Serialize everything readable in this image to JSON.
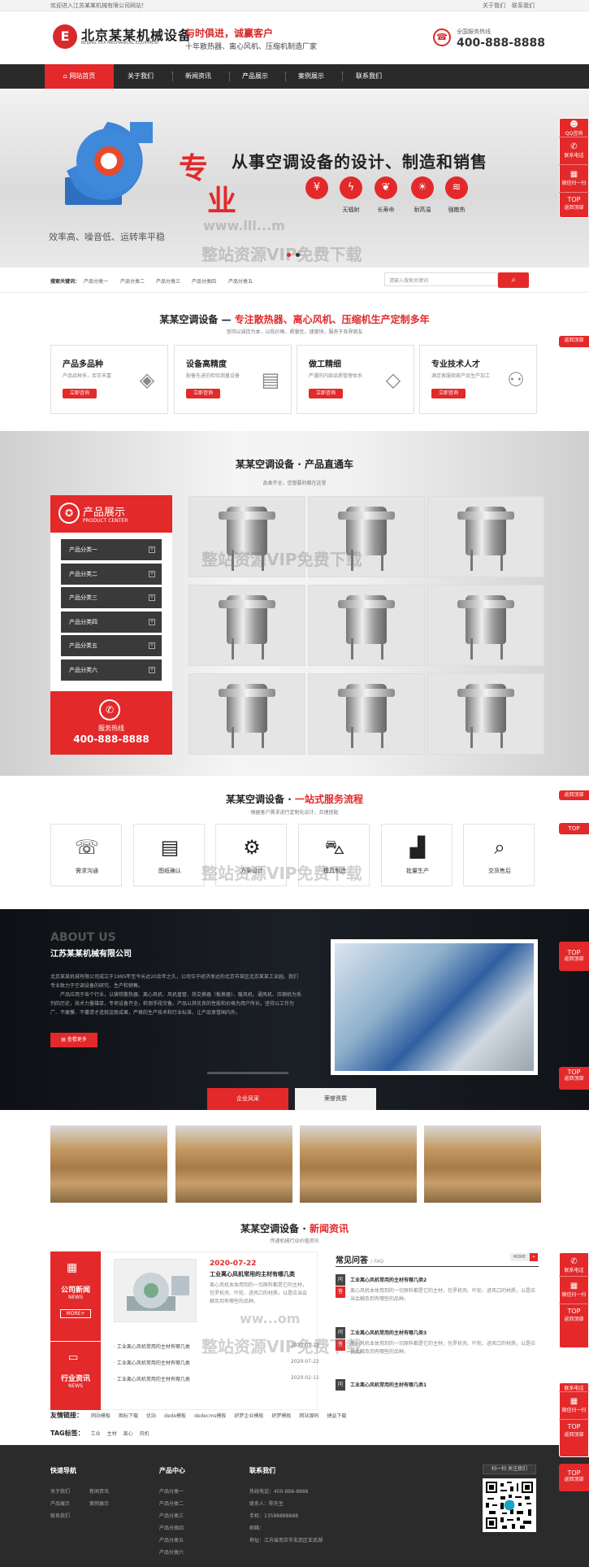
{
  "topbar": {
    "welcome": "欢迎进入江苏某某机械有限公司网站！",
    "links": [
      "关于我们",
      "联系我们"
    ]
  },
  "header": {
    "logo_mark": "E",
    "logo_name": "北京某某机械设备",
    "logo_en": "BEIJING XXX MECHANICAL EQUIPMENT",
    "slogan1": "与时俱进，诚赢客户",
    "slogan2": "十年散热器、离心风机、压缩机制造厂家",
    "hotline_label": "全国服务热线",
    "hotline": "400-888-8888"
  },
  "nav": {
    "home": "网站首页",
    "items": [
      "关于我们",
      "新闻资讯",
      "产品展示",
      "案例展示",
      "联系我们"
    ]
  },
  "banner": {
    "big_char1": "专",
    "big_char2": "业",
    "headline": "从事空调设备的设计、制造和销售",
    "features": [
      {
        "label": "",
        "icon": "¥"
      },
      {
        "label": "无辐射",
        "icon": "ϟ"
      },
      {
        "label": "长寿命",
        "icon": "❦"
      },
      {
        "label": "耐高温",
        "icon": "☀"
      },
      {
        "label": "强散热",
        "icon": "≋"
      }
    ],
    "subtitle": "效率高、噪音低、运转率平稳",
    "watermark1": "www.lll...m",
    "watermark2": "整站资源VIP免费下载"
  },
  "search": {
    "label": "搜索关键词：",
    "keywords": [
      "产品分类一",
      "产品分类二",
      "产品分类三",
      "产品分类四",
      "产品分类五"
    ],
    "placeholder": "请输入搜索关键词"
  },
  "intro": {
    "title_a": "某某空调设备 — ",
    "title_b": "专注散热器、离心风机、压缩机生产定制多年",
    "subtitle": "坚持以诚信为本，以低价格，质量优，速度快，服务于各界朋友",
    "cards": [
      {
        "title": "产品多品种",
        "desc": "产品品种多，库存丰富",
        "button": "立即咨询",
        "icon": "layers-icon"
      },
      {
        "title": "设备高精度",
        "desc": "配备先进的检验测量设备",
        "button": "立即咨询",
        "icon": "certificate-icon"
      },
      {
        "title": "做工精细",
        "desc": "严谨的内部品质管理体系",
        "button": "立即咨询",
        "icon": "diamond-icon"
      },
      {
        "title": "专业技术人才",
        "desc": "满足客服商家产品生产加工",
        "button": "立即咨询",
        "icon": "users-icon"
      }
    ]
  },
  "products": {
    "title": "某某空调设备 · 产品直通车",
    "subtitle": "品类齐全，您想要的都在这里",
    "center_title": "产品展示",
    "center_en": "PRODUCT CENTER",
    "categories": [
      "产品分类一",
      "产品分类二",
      "产品分类三",
      "产品分类四",
      "产品分类五",
      "产品分类六"
    ],
    "hot_label": "服务热线",
    "hot_number": "400-888-8888"
  },
  "flow": {
    "title_a": "某某空调设备 · ",
    "title_b": "一站式服务流程",
    "subtitle": "根据客户需求进行定制化设计，合理搭配",
    "steps": [
      {
        "label": "需求沟通",
        "icon": "☏"
      },
      {
        "label": "图纸确认",
        "icon": "▤"
      },
      {
        "label": "方案设计",
        "icon": "⚙"
      },
      {
        "label": "模具制造",
        "icon": "⛍"
      },
      {
        "label": "批量生产",
        "icon": "▟"
      },
      {
        "label": "交货售后",
        "icon": "⌕"
      }
    ]
  },
  "about": {
    "en": "ABOUT US",
    "cn": "江苏某某机械有限公司",
    "text1": "北京某某机械有限公司成立于1995年至今长达20余年之久，公司位于经济发达的北京市某区北京某某工业园，我们专业致力于空调设备的研究、生产和销售。",
    "text2": "产品应用于各个行业，以铸铁散热器、离心风机、风机盘管、热交换器（板换器）、暖风机、通风机、压缩机为系列的历史，技术力量雄厚，专项设备齐全，检测手段完备。产品以其优良的性能和价格为用户所长。坚持以工作为广、不敢懈、不撒谎才造就这般成果，严格的生产技术和行业标准，让产品享誉国内外。",
    "more": "查看更多",
    "tab_active": "企业风采",
    "tab_other": "荣誉资质"
  },
  "news": {
    "title_a": "某某空调设备 · ",
    "title_b": "新闻资讯",
    "subtitle": "传递机械行业价值资讯",
    "company_news": "公司新闻",
    "company_news_en": "NEWS",
    "more": "MORE+",
    "industry_news": "行业资讯",
    "industry_news_en": "NEWS",
    "featured_date": "2020-07-22",
    "featured_title": "工业离心风机常用的主材有哪几类",
    "featured_desc": "离心风机本体用到的一切原料都是它的主材，包罗机壳、叶轮、进风口的材质，以是应当会触及到有哪些的品种。",
    "list": [
      {
        "title": "工业离心风机常用的主材有哪几类",
        "date": "2020-07-22"
      },
      {
        "title": "工业离心风机常用的主材有哪几类",
        "date": "2020-07-22"
      },
      {
        "title": "工业离心风机常用的主材有哪几类",
        "date": "2020-02-11"
      }
    ],
    "faq_title": "常见问答",
    "faq_en": "/ FAQ",
    "faq_more": "MORE",
    "faq": [
      {
        "q": "工业离心风机常用的主材有哪几类2",
        "a": "离心风机本体用到的一切原料都是它的主材，包罗机壳、叶轮、进风口的材质，以是应当会触及到有哪些的品种。"
      },
      {
        "q": "工业离心风机常用的主材有哪几类3",
        "a": "离心风机本体用到的一切原料都是它的主材，包罗机壳、叶轮、进风口的材质，以是应当会触及到有哪些的品种。"
      },
      {
        "q": "工业离心风机常用的主材有哪几类1",
        "a": ""
      }
    ]
  },
  "friend_links": {
    "label": "友情链接：",
    "items": [
      "网站模板",
      "图标下载",
      "优站",
      "dede模板",
      "dedecms模板",
      "织梦企业模板",
      "织梦模板",
      "网站源码",
      "捷益下载"
    ]
  },
  "tags": {
    "label": "TAG标签：",
    "items": [
      "工业",
      "主材",
      "离心",
      "风机"
    ]
  },
  "footer": {
    "nav_title": "快速导航",
    "nav_items": [
      "关于我们",
      "新闻资讯",
      "产品展示",
      "案例展示",
      "联系我们"
    ],
    "prod_title": "产品中心",
    "prod_items": [
      "产品分类一",
      "产品分类二",
      "产品分类三",
      "产品分类四",
      "产品分类五",
      "产品分类六"
    ],
    "contact_title": "联系我们",
    "contact_items": [
      "热线电话：400-888-8888",
      "联系人：陈先生",
      "手机：13588888888",
      "邮箱：",
      "地址：江苏省南京市玄武区玄武湖"
    ],
    "qr_label": "扫一扫 关注我们"
  },
  "side": {
    "qq": "QQ咨询",
    "phone": "联系电话",
    "wechat": "微信扫一扫",
    "top": "TOP",
    "top_sub": "返回顶部",
    "watermark3": "整站资源VIP免费下载",
    "watermark4": "ww...om"
  },
  "colors": {
    "accent": "#e3292a",
    "dark": "#2a2a2a"
  }
}
